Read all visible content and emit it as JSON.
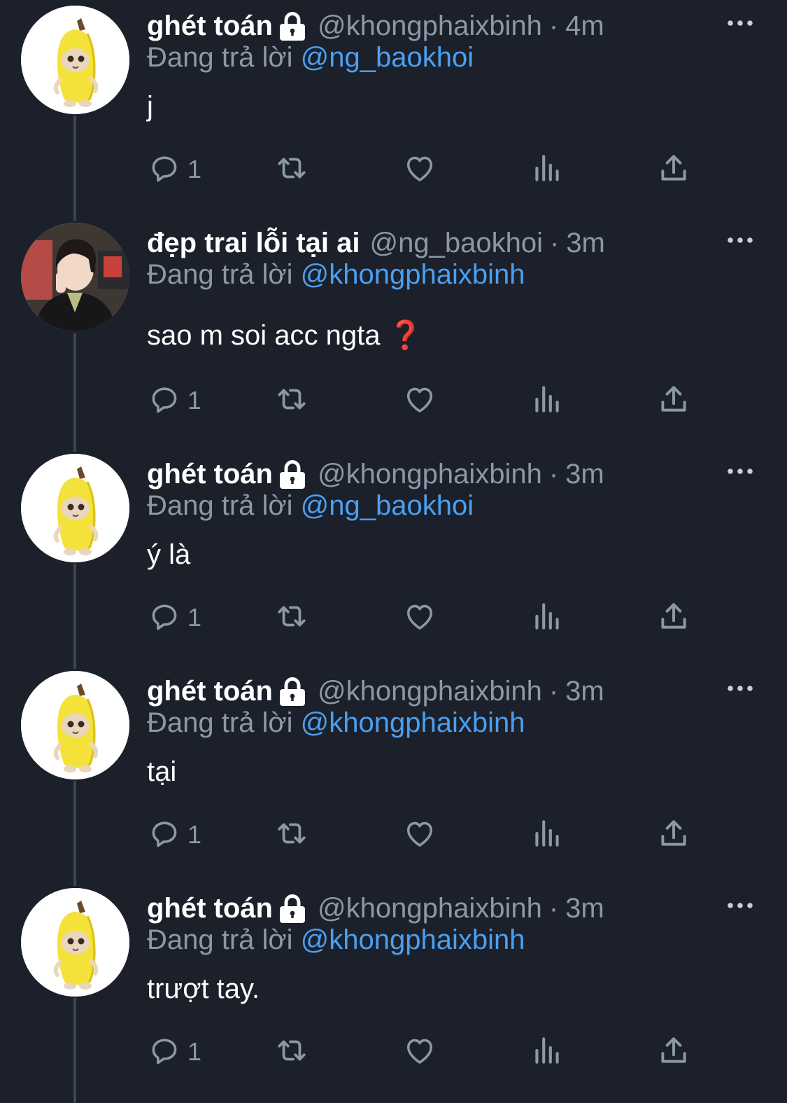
{
  "colors": {
    "background": "#1b202a",
    "text_primary": "#ffffff",
    "text_secondary": "#8b98a5",
    "mention": "#4b9ff0",
    "thread_line": "#3d4651",
    "question_mark": "#d92b2b"
  },
  "tweets": [
    {
      "avatar": "banana-cat-avatar",
      "display_name": "ghét toán",
      "locked": true,
      "handle": "@khongphaixbinh",
      "separator": "·",
      "time": "4m",
      "reply_label": "Đang trả lời",
      "reply_to": "@ng_baokhoi",
      "text": "j",
      "reply_count": "1"
    },
    {
      "avatar": "person-avatar",
      "display_name": "đẹp trai lỗi tại ai",
      "locked": false,
      "handle": "@ng_baokhoi",
      "separator": "·",
      "time": "3m",
      "reply_label": "Đang trả lời",
      "reply_to": "@khongphaixbinh",
      "text": "sao m soi acc ngta",
      "emoji": "❓",
      "reply_count": "1"
    },
    {
      "avatar": "banana-cat-avatar",
      "display_name": "ghét toán",
      "locked": true,
      "handle": "@khongphaixbinh",
      "separator": "·",
      "time": "3m",
      "reply_label": "Đang trả lời",
      "reply_to": "@ng_baokhoi",
      "text": "ý là",
      "reply_count": "1"
    },
    {
      "avatar": "banana-cat-avatar",
      "display_name": "ghét toán",
      "locked": true,
      "handle": "@khongphaixbinh",
      "separator": "·",
      "time": "3m",
      "reply_label": "Đang trả lời",
      "reply_to": "@khongphaixbinh",
      "text": "tại",
      "reply_count": "1"
    },
    {
      "avatar": "banana-cat-avatar",
      "display_name": "ghét toán",
      "locked": true,
      "handle": "@khongphaixbinh",
      "separator": "·",
      "time": "3m",
      "reply_label": "Đang trả lời",
      "reply_to": "@khongphaixbinh",
      "text": "trượt tay.",
      "reply_count": "1"
    }
  ],
  "icons": {
    "reply": "speech-bubble-icon",
    "retweet": "retweet-icon",
    "like": "heart-icon",
    "views": "bar-chart-icon",
    "share": "share-upload-icon",
    "more": "ellipsis-icon",
    "lock": "lock-icon"
  }
}
